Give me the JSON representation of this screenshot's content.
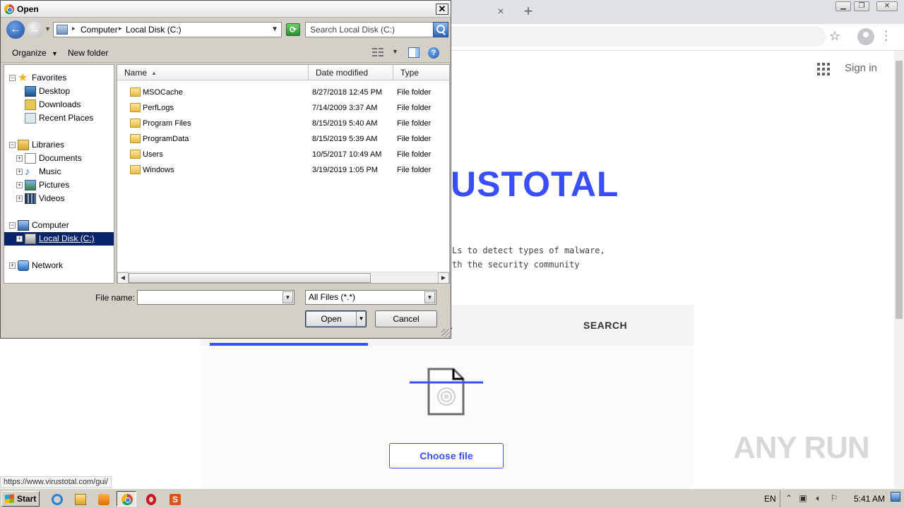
{
  "browser": {
    "new_tab_symbol": "+",
    "tab_close_symbol": "×",
    "signin_label": "Sign in",
    "status_url": "https://www.virustotal.com/gui/"
  },
  "virustotal": {
    "logo_visible": "USTOTAL",
    "description_line1": "Ls to detect types of malware,",
    "description_line2": "th the security community",
    "tab_url_visible": "L",
    "tab_search": "SEARCH",
    "choose_file": "Choose file",
    "brand_color": "#394eff",
    "watermark": "ANY RUN"
  },
  "dialog": {
    "title": "Open",
    "close_symbol": "✕",
    "address": {
      "crumbs": [
        "Computer",
        "Local Disk (C:)"
      ]
    },
    "search_placeholder": "Search Local Disk (C:)",
    "toolbar": {
      "organize": "Organize",
      "new_folder": "New folder"
    },
    "tree": {
      "favorites": "Favorites",
      "desktop": "Desktop",
      "downloads": "Downloads",
      "recent": "Recent Places",
      "libraries": "Libraries",
      "documents": "Documents",
      "music": "Music",
      "pictures": "Pictures",
      "videos": "Videos",
      "computer": "Computer",
      "local_disk": "Local Disk (C:)",
      "network": "Network"
    },
    "columns": {
      "name": "Name",
      "date": "Date modified",
      "type": "Type"
    },
    "files": [
      {
        "name": "MSOCache",
        "date": "8/27/2018 12:45 PM",
        "type": "File folder"
      },
      {
        "name": "PerfLogs",
        "date": "7/14/2009 3:37 AM",
        "type": "File folder"
      },
      {
        "name": "Program Files",
        "date": "8/15/2019 5:40 AM",
        "type": "File folder"
      },
      {
        "name": "ProgramData",
        "date": "8/15/2019 5:39 AM",
        "type": "File folder"
      },
      {
        "name": "Users",
        "date": "10/5/2017 10:49 AM",
        "type": "File folder"
      },
      {
        "name": "Windows",
        "date": "3/19/2019 1:05 PM",
        "type": "File folder"
      }
    ],
    "file_name_label": "File name:",
    "file_name_value": "",
    "filter_value": "All Files (*.*)",
    "open_label": "Open",
    "cancel_label": "Cancel"
  },
  "taskbar": {
    "start_label": "Start",
    "s_icon_letter": "S",
    "language": "EN",
    "time": "5:41 AM"
  }
}
